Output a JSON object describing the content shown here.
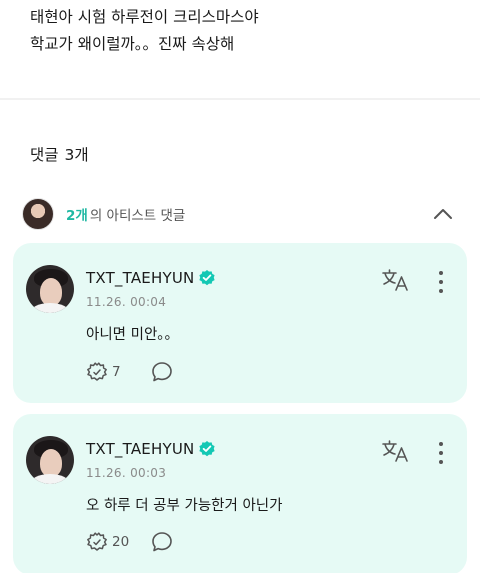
{
  "post": {
    "line1": "태현아 시험 하루전이 크리스마스야",
    "line2": "학교가 왜이럴까。。진짜 속상해"
  },
  "comments_section": {
    "heading": "댓글",
    "count": "3개"
  },
  "artist_summary": {
    "count": "2개",
    "label": "의 아티스트 댓글"
  },
  "comments": [
    {
      "author": "TXT_TAEHYUN",
      "time": "11.26. 00:04",
      "text": "아니면 미안。。",
      "likes": "7"
    },
    {
      "author": "TXT_TAEHYUN",
      "time": "11.26. 00:03",
      "text": "오 하루 더 공부 가능한거 아닌가",
      "likes": "20"
    }
  ],
  "colors": {
    "card_background": "#e6faf5",
    "accent": "#1fb8a3",
    "verified_badge": "#14c8b4"
  },
  "icons": [
    "verified-badge-icon",
    "translate-icon",
    "more-vertical-icon",
    "like-icon",
    "reply-icon",
    "chevron-up-icon"
  ]
}
